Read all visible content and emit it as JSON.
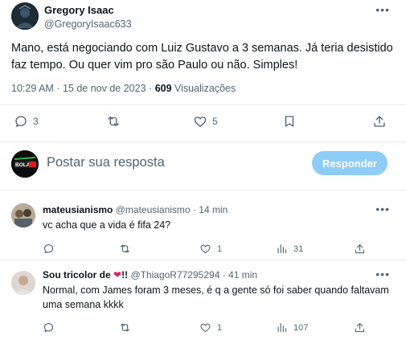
{
  "post": {
    "author": {
      "name": "Gregory Isaac",
      "handle": "@GregoryIsaac633"
    },
    "text": "Mano, está negociando com Luiz Gustavo a 3 semanas. Já teria desistido faz tempo. Ou quer vim pro são Paulo ou não. Simples!",
    "time": "10:29 AM",
    "date": "15 de nov de 2023",
    "views_count": "609",
    "views_label": "Visualizações",
    "actions": {
      "replies": "3",
      "retweets": "",
      "likes": "5"
    }
  },
  "composer": {
    "placeholder": "Postar sua resposta",
    "reply_button": "Responder"
  },
  "replies": [
    {
      "name": "mateusianismo",
      "handle": "@mateusianismo",
      "time": "14 min",
      "text": "vc acha que a vida é fifa 24?",
      "likes": "1",
      "views": "31"
    },
    {
      "name": "Sou tricolor de",
      "name_suffix": "!!",
      "handle": "@ThiagoR77295294",
      "time": "41 min",
      "text": "Normal, com James foram 3 meses, é q a gente só foi saber quando faltavam uma semana kkkk",
      "likes": "1",
      "views": "107"
    }
  ],
  "colors": {
    "reply_button_bg": "#8ecdf8",
    "heart": "#e0245e",
    "secondary_text": "#536471"
  },
  "icons": [
    "reply-icon",
    "retweet-icon",
    "like-icon",
    "bookmark-icon",
    "share-icon",
    "views-icon",
    "more-icon"
  ],
  "separator": "·"
}
